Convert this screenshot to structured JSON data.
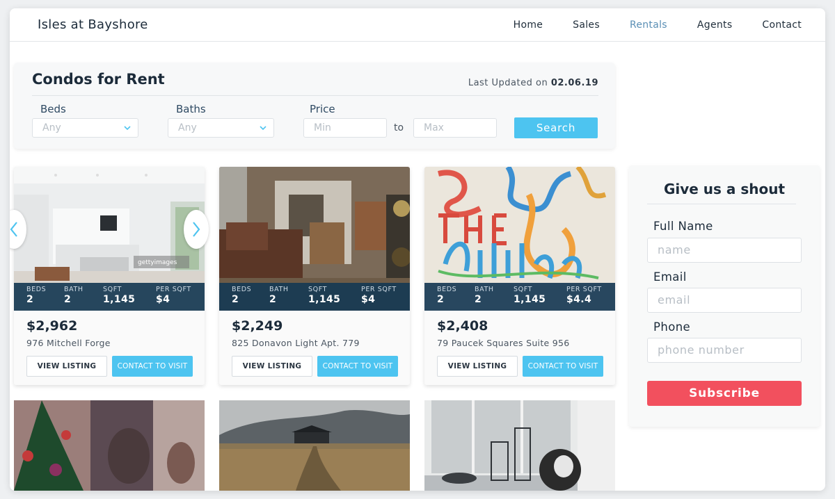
{
  "header": {
    "brand": "Isles at Bayshore",
    "nav": [
      "Home",
      "Sales",
      "Rentals",
      "Agents",
      "Contact"
    ],
    "active_nav": "Rentals"
  },
  "search": {
    "title": "Condos for Rent",
    "updated_prefix": "Last Updated on",
    "updated_date": "02.06.19",
    "beds_label": "Beds",
    "beds_value": "Any",
    "baths_label": "Baths",
    "baths_value": "Any",
    "price_label": "Price",
    "min_placeholder": "Min",
    "to": "to",
    "max_placeholder": "Max",
    "search_button": "Search"
  },
  "stat_keys": {
    "beds": "BEDS",
    "bath": "BATH",
    "sqft": "SQFT",
    "per_sqft": "PER SQFT"
  },
  "listings": [
    {
      "beds": "2",
      "bath": "2",
      "sqft": "1,145",
      "per_sqft": "$4",
      "price": "$2,962",
      "address": "976 Mitchell Forge",
      "watermark": "gettyimages"
    },
    {
      "beds": "2",
      "bath": "2",
      "sqft": "1,145",
      "per_sqft": "$4",
      "price": "$2,249",
      "address": "825 Donavon Light Apt. 779"
    },
    {
      "beds": "2",
      "bath": "2",
      "sqft": "1,145",
      "per_sqft": "$4.4",
      "price": "$2,408",
      "address": "79 Paucek Squares Suite 956"
    }
  ],
  "buttons": {
    "view": "VIEW LISTING",
    "contact": "CONTACT TO VISIT"
  },
  "contact_form": {
    "title": "Give us a shout",
    "name_label": "Full Name",
    "name_placeholder": "name",
    "email_label": "Email",
    "email_placeholder": "email",
    "phone_label": "Phone",
    "phone_placeholder": "phone number",
    "subscribe": "Subscribe"
  },
  "colors": {
    "accent": "#4dc4f0",
    "subscribe": "#f2505e",
    "nav_active": "#5a8fb5",
    "stat_bar": "#173a54"
  },
  "icons": [
    "chevron-down-icon",
    "chevron-left-icon",
    "chevron-right-icon"
  ]
}
